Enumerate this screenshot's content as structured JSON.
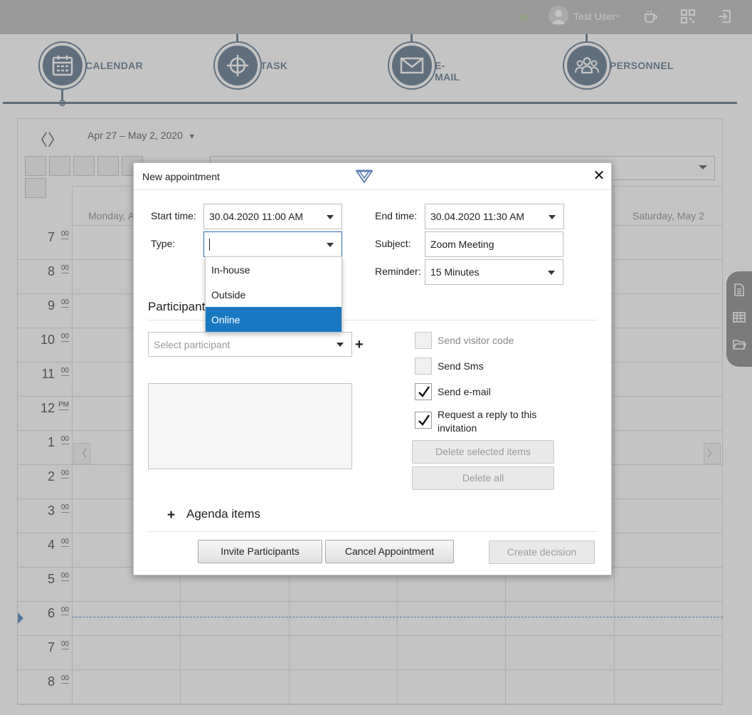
{
  "topbar": {
    "user_name": "Test User",
    "user_chevron": "⌄",
    "icons": [
      "user-avatar-icon",
      "coffee-cup-icon",
      "qr-code-icon",
      "logout-icon"
    ]
  },
  "modules": [
    {
      "label": "CALENDAR",
      "icon": "calendar-icon",
      "active": true
    },
    {
      "label": "TASK",
      "icon": "crosshair-icon",
      "active": false
    },
    {
      "label": "E-MAIL",
      "icon": "envelope-icon",
      "active": false
    },
    {
      "label": "PERSONNEL",
      "icon": "people-icon",
      "active": false
    }
  ],
  "calendar": {
    "range": "Apr 27 – May 2, 2020",
    "range_chevron": "▾",
    "prev": "〈",
    "next": "〉",
    "day_headers": [
      "Monday, A",
      "Saturday, May 2"
    ],
    "hours": [
      {
        "n": "7",
        "m": "00"
      },
      {
        "n": "8",
        "m": "00"
      },
      {
        "n": "9",
        "m": "00"
      },
      {
        "n": "10",
        "m": "00"
      },
      {
        "n": "11",
        "m": "00"
      },
      {
        "n": "12",
        "m": "PM"
      },
      {
        "n": "1",
        "m": "00"
      },
      {
        "n": "2",
        "m": "00"
      },
      {
        "n": "3",
        "m": "00"
      },
      {
        "n": "4",
        "m": "00"
      },
      {
        "n": "5",
        "m": "00"
      },
      {
        "n": "6",
        "m": "00"
      },
      {
        "n": "7",
        "m": "00"
      },
      {
        "n": "8",
        "m": "00"
      }
    ],
    "side_prev": "〈",
    "side_next": "〉"
  },
  "side_tools": [
    "document-icon",
    "table-icon",
    "folder-open-icon"
  ],
  "dialog": {
    "title": "New appointment",
    "close": "✕",
    "start_label": "Start time:",
    "start_value": "30.04.2020 11:00 AM",
    "end_label": "End time:",
    "end_value": "30.04.2020 11:30 AM",
    "type_label": "Type:",
    "type_value": "",
    "subject_label": "Subject:",
    "subject_value": "Zoom Meeting",
    "reminder_label": "Reminder:",
    "reminder_value": "15 Minutes",
    "type_options": [
      {
        "label": "In-house",
        "selected": false
      },
      {
        "label": "Outside",
        "selected": false
      },
      {
        "label": "Online",
        "selected": true
      }
    ],
    "participants_heading": "Participant",
    "participant_placeholder": "Select participant",
    "add_symbol": "+",
    "checkboxes": [
      {
        "label": "Send visitor code",
        "checked": false,
        "disabled": true
      },
      {
        "label": "Send Sms",
        "checked": false,
        "disabled": false
      },
      {
        "label": "Send e-mail",
        "checked": true,
        "disabled": false
      },
      {
        "label": "Request a reply to this invitation",
        "checked": true,
        "disabled": false
      }
    ],
    "delete_selected_label": "Delete selected items",
    "delete_all_label": "Delete all",
    "agenda_symbol": "+",
    "agenda_label": "Agenda items",
    "invite_label": "Invite Participants",
    "cancel_label": "Cancel Appointment",
    "create_decision_label": "Create decision"
  },
  "colors": {
    "topbar": "#c2c2c2",
    "module_accent": "#6c8298",
    "selection_blue": "#1a78c2",
    "now_line": "#5b8fc6"
  }
}
